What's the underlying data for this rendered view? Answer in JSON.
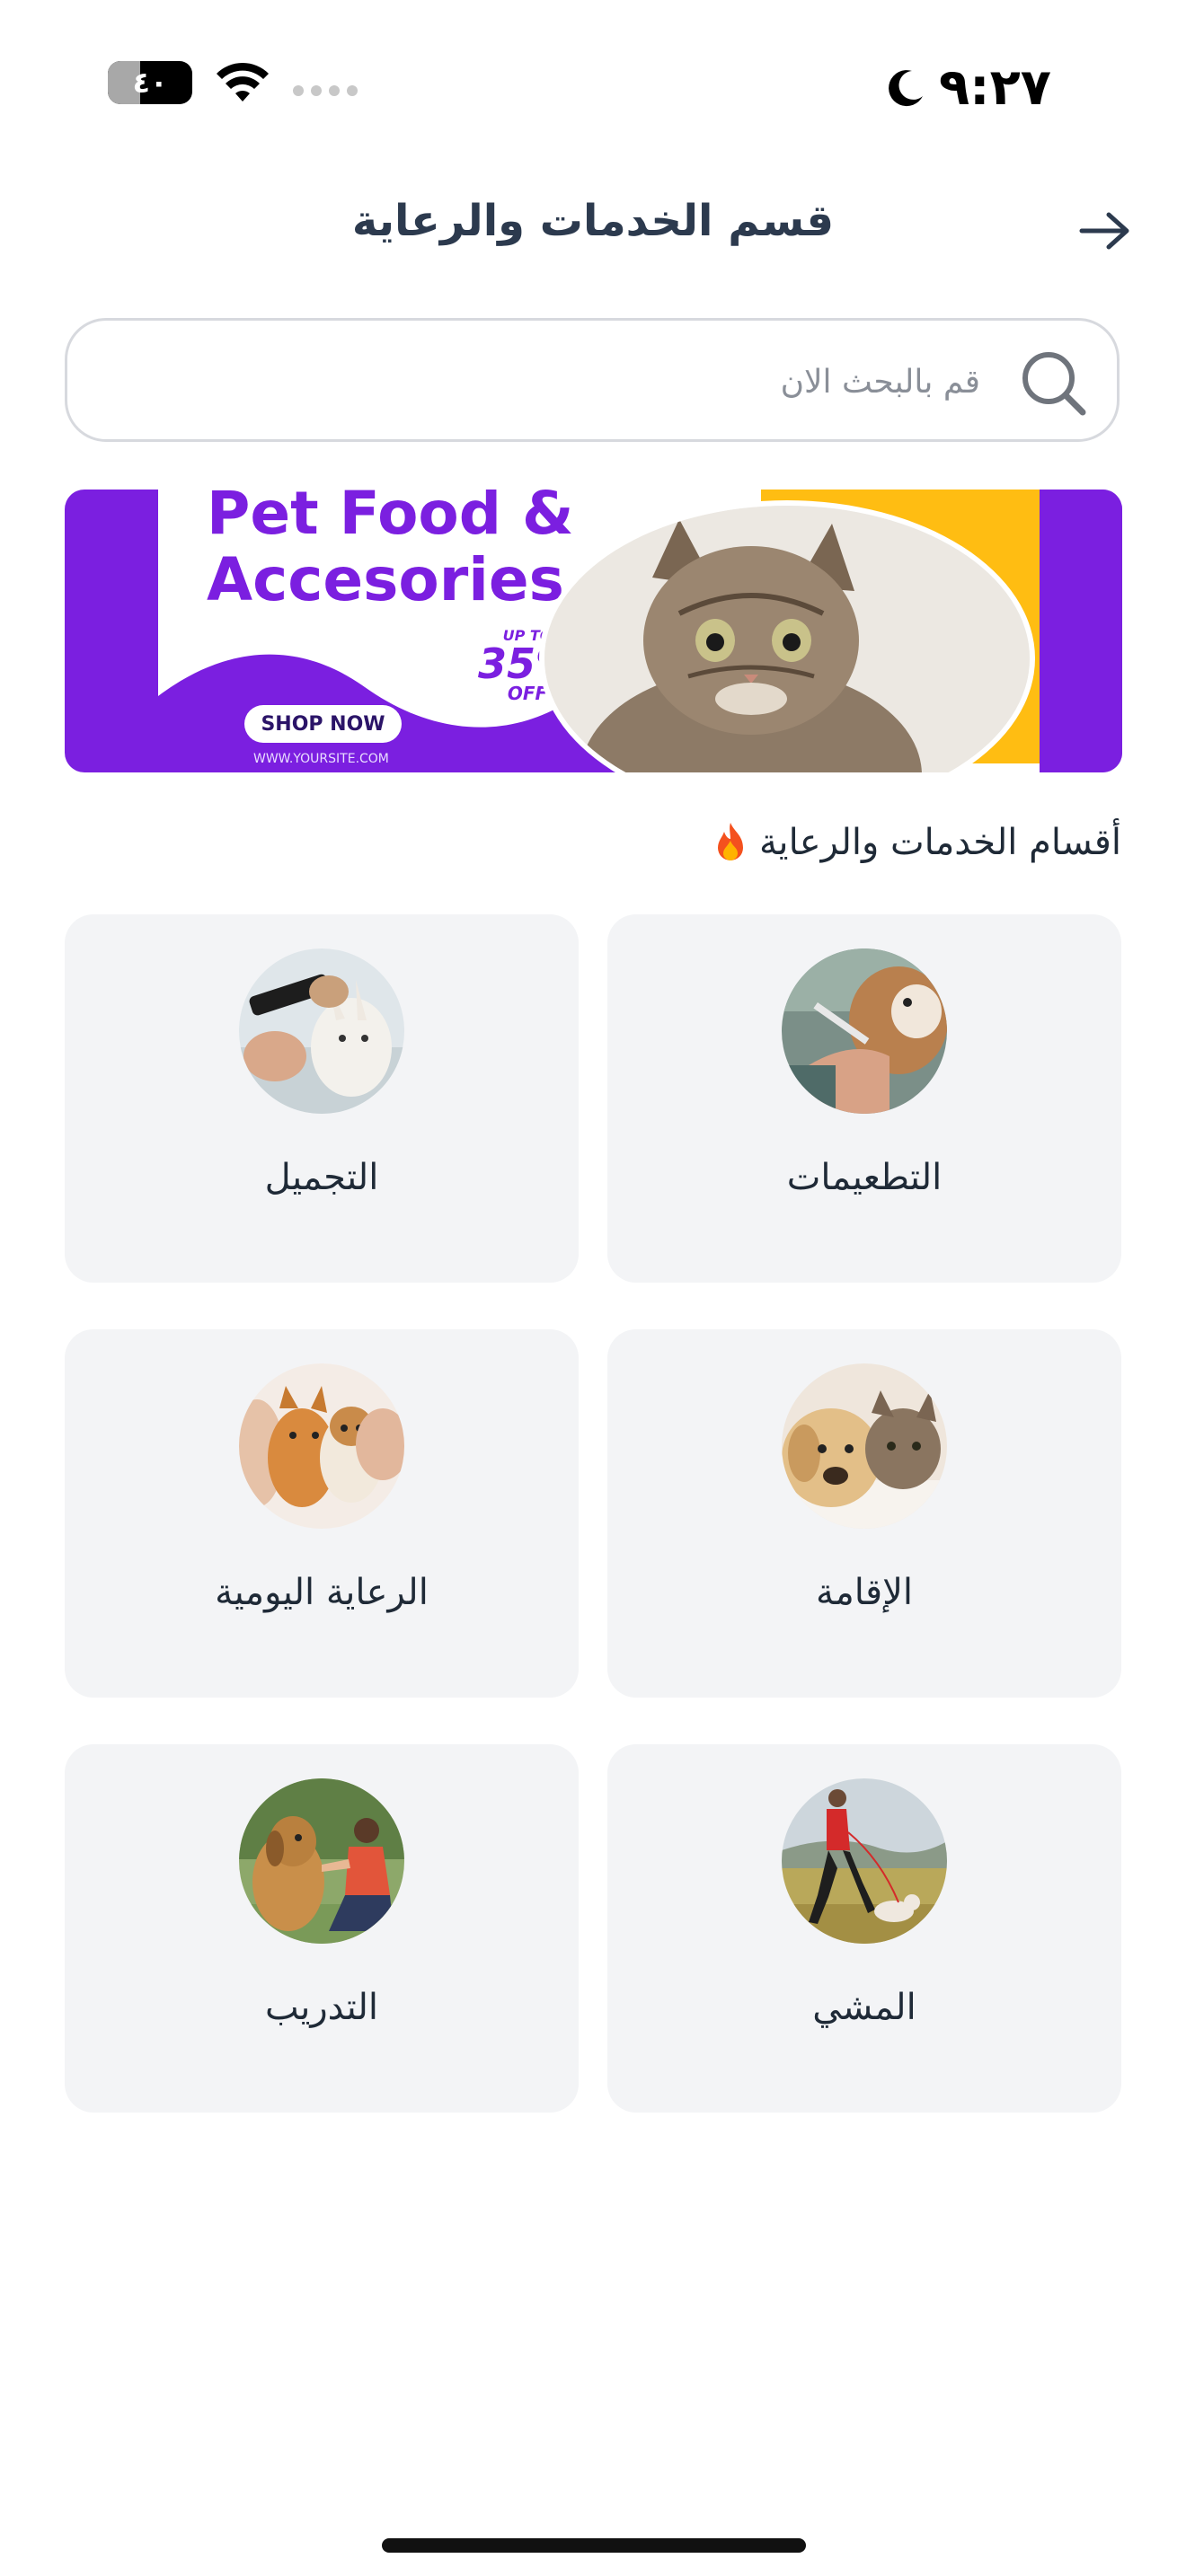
{
  "status_bar": {
    "time": "٩:٢٧",
    "battery_level": "٤٠"
  },
  "header": {
    "title": "قسم الخدمات والرعاية"
  },
  "search": {
    "placeholder": "قم بالبحث الان",
    "value": ""
  },
  "banner": {
    "headline": "Pet Food &\nAccesories",
    "discount_prefix": "UP TO",
    "discount_value": "35%",
    "discount_suffix": "OFF",
    "cta_label": "SHOP NOW",
    "site": "WWW.YOURSITE.COM"
  },
  "section": {
    "title": "أقسام الخدمات والرعاية",
    "icon": "fire-icon"
  },
  "categories": [
    {
      "label": "التطعيمات",
      "icon": "vaccination-photo"
    },
    {
      "label": "التجميل",
      "icon": "grooming-photo"
    },
    {
      "label": "الإقامة",
      "icon": "boarding-photo"
    },
    {
      "label": "الرعاية اليومية",
      "icon": "daycare-photo"
    },
    {
      "label": "المشي",
      "icon": "walking-photo"
    },
    {
      "label": "التدريب",
      "icon": "training-photo"
    }
  ],
  "colors": {
    "title": "#2c3a4e",
    "card_background": "#f3f4f6",
    "banner_purple": "#7b1fe0",
    "banner_yellow": "#ffbd12"
  }
}
